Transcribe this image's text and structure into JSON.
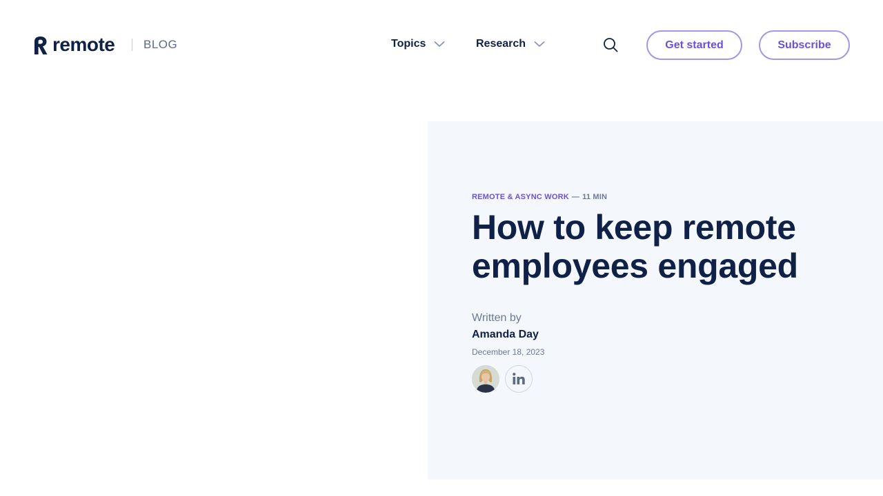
{
  "header": {
    "logo_text": "remote",
    "section_label": "BLOG",
    "nav": [
      {
        "label": "Topics"
      },
      {
        "label": "Research"
      }
    ],
    "search_icon": "search-icon",
    "get_started_label": "Get started",
    "subscribe_label": "Subscribe"
  },
  "article": {
    "category": "REMOTE & ASYNC WORK",
    "separator": "—",
    "read_time": "11 MIN",
    "title": "How to keep remote employees engaged",
    "written_by_label": "Written by",
    "author": "Amanda Day",
    "date": "December 18, 2023",
    "social_icon": "linkedin-icon"
  },
  "colors": {
    "brand_navy": "#0f2147",
    "accent_purple": "#6e4fd9",
    "button_border": "#a495e6",
    "hero_background": "#f4f7fb",
    "muted_text": "#6b7a95"
  }
}
